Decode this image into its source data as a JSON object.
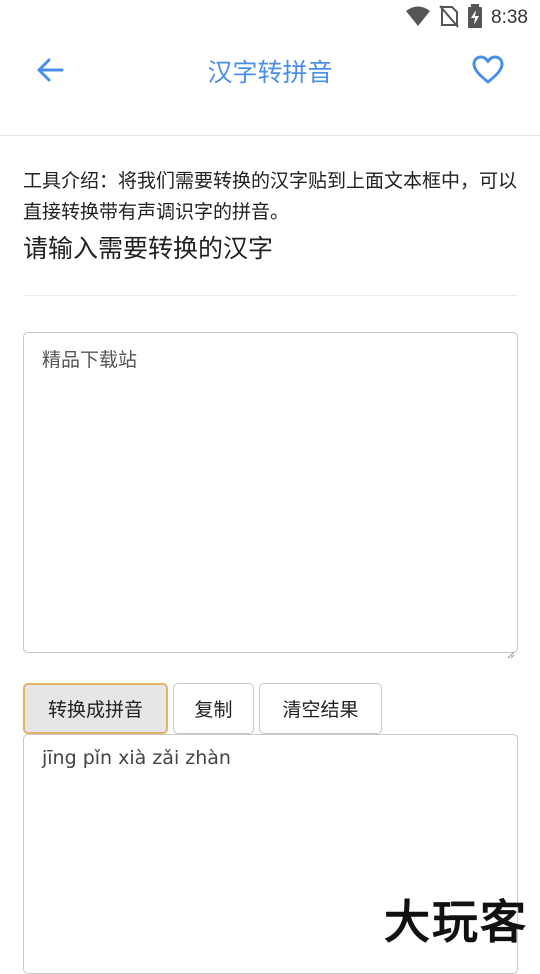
{
  "status_bar": {
    "time": "8:38",
    "icons": [
      "wifi-icon",
      "no-sim-icon",
      "battery-charging-icon"
    ]
  },
  "app_bar": {
    "title": "汉字转拼音",
    "back_icon": "arrow-left-icon",
    "favorite_icon": "heart-outline-icon"
  },
  "main": {
    "intro_text": "工具介绍：将我们需要转换的汉字贴到上面文本框中，可以直接转换带有声调识字的拼音。",
    "input_heading": "请输入需要转换的汉字",
    "input_value": "精品下载站",
    "buttons": {
      "convert": "转换成拼音",
      "copy": "复制",
      "clear": "清空结果"
    },
    "output_value": "jīng pǐn xià zǎi zhàn"
  },
  "watermark": "大玩客",
  "colors": {
    "accent": "#4a8fe7",
    "primary_button_border": "#e3b36a"
  }
}
